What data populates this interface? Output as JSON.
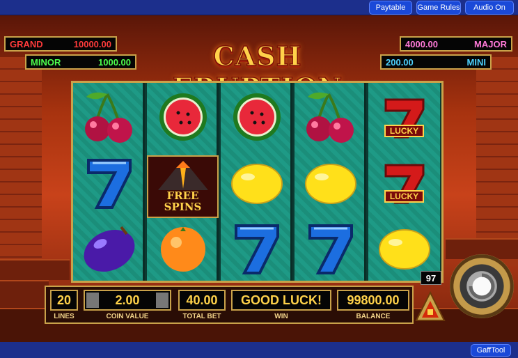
{
  "menu": {
    "paytable": "Paytable",
    "game_rules": "Game Rules",
    "audio": "Audio On",
    "gafftool": "GaffTool"
  },
  "jackpots": {
    "grand": {
      "label": "GRAND",
      "value": "10000.00",
      "color": "#ff3b3b"
    },
    "minor": {
      "label": "MINOR",
      "value": "1000.00",
      "color": "#4dff4d"
    },
    "major": {
      "label": "MAJOR",
      "value": "4000.00",
      "color": "#ff7ad9"
    },
    "mini": {
      "label": "MINI",
      "value": "200.00",
      "color": "#4dd2ff"
    }
  },
  "logo": "CASH ERUPTION",
  "reels": [
    [
      "cherry-icon",
      "blue-seven-icon",
      "plum-icon"
    ],
    [
      "watermelon-icon",
      "free-spins-volcano-icon",
      "orange-icon"
    ],
    [
      "watermelon-icon",
      "lemon-icon",
      "blue-seven-icon"
    ],
    [
      "cherry-icon",
      "lemon-icon",
      "blue-seven-icon"
    ],
    [
      "lucky-seven-icon",
      "lucky-seven-icon",
      "lemon-icon"
    ]
  ],
  "free_spins": {
    "line1": "FREE",
    "line2": "SPINS"
  },
  "lucky": "LUCKY",
  "panel": {
    "lines": {
      "value": "20",
      "label": "LINES"
    },
    "coin_value": {
      "value": "2.00",
      "label": "COIN VALUE"
    },
    "total_bet": {
      "value": "40.00",
      "label": "TOTAL BET"
    },
    "win": {
      "value": "GOOD LUCK!",
      "label": "WIN"
    },
    "balance": {
      "value": "99800.00",
      "label": "BALANCE"
    }
  },
  "auto_count": "97"
}
